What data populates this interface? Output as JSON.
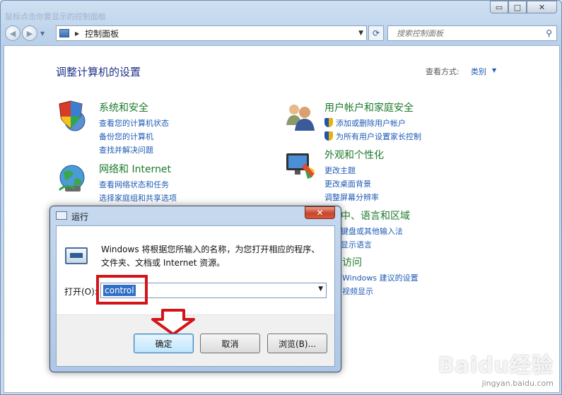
{
  "window": {
    "blurred_title": "鼠标点击你要显示的控制面板",
    "controls": {
      "minimize": "▭",
      "maximize": "□",
      "close": "✕"
    }
  },
  "nav": {
    "back_glyph": "◀",
    "forward_glyph": "▶",
    "address_crumb": "控制面板",
    "search_placeholder": "搜索控制面板"
  },
  "page": {
    "title": "调整计算机的设置",
    "view_by_label": "查看方式:",
    "view_by_value": "类别"
  },
  "categories": {
    "system": {
      "title": "系统和安全",
      "links": [
        "查看您的计算机状态",
        "备份您的计算机",
        "查找并解决问题"
      ]
    },
    "network": {
      "title": "网络和 Internet",
      "links": [
        "查看网络状态和任务",
        "选择家庭组和共享选项"
      ]
    },
    "users": {
      "title": "用户帐户和家庭安全",
      "links": [
        "添加或删除用户帐户",
        "为所有用户设置家长控制"
      ]
    },
    "appearance": {
      "title": "外观和个性化",
      "links": [
        "更改主题",
        "更改桌面背景",
        "调整屏幕分辨率"
      ]
    },
    "region": {
      "title": "中、语言和区域",
      "links": [
        "键盘或其他输入法",
        "显示语言"
      ]
    },
    "access": {
      "title": "访问",
      "links": [
        "Windows 建议的设置",
        "视频显示"
      ]
    }
  },
  "run_dialog": {
    "title": "运行",
    "close": "✕",
    "description": "Windows 将根据您所输入的名称，为您打开相应的程序、文件夹、文档或 Internet 资源。",
    "open_label": "打开(O):",
    "open_value": "control",
    "ok": "确定",
    "cancel": "取消",
    "browse": "浏览(B)..."
  },
  "watermark": {
    "logo": "Baidu经验",
    "url": "jingyan.baidu.com"
  },
  "colors": {
    "highlight": "#d3151a",
    "category_title": "#1d7a2b",
    "link": "#1e5bb6",
    "page_title": "#1e3287"
  }
}
